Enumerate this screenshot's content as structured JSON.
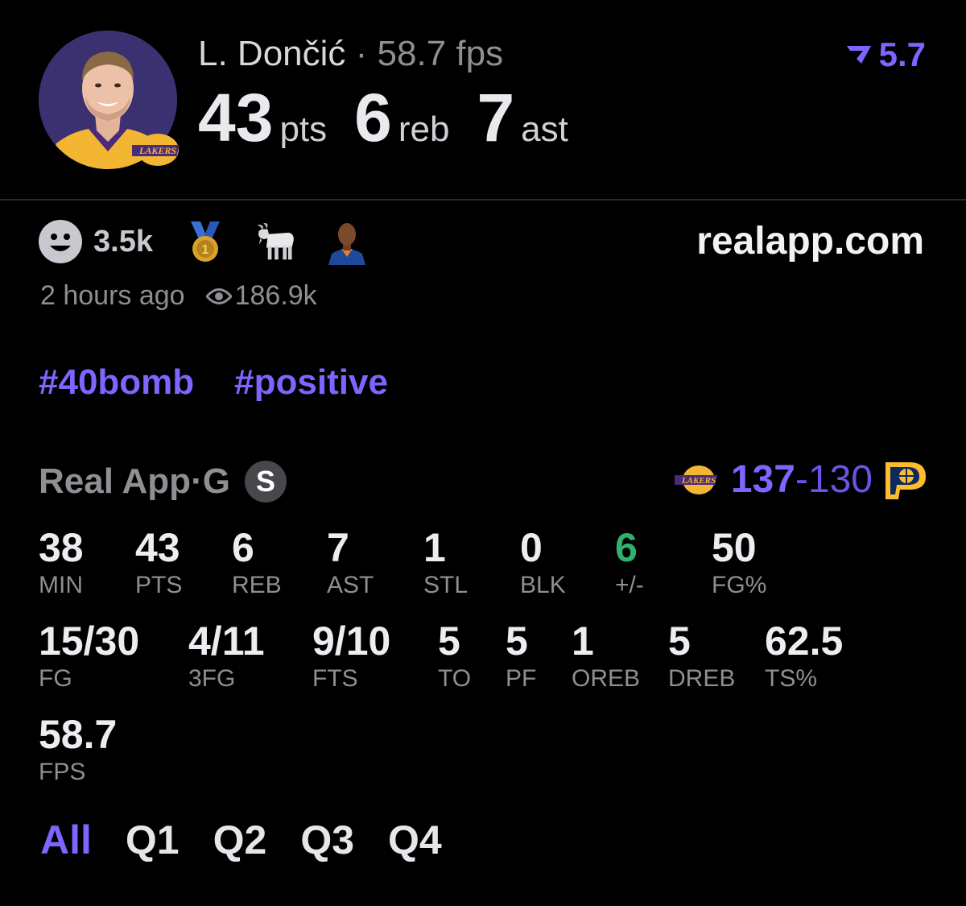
{
  "header": {
    "player_name": "L. Dončić",
    "separator": " · ",
    "fps_text": "58.7 fps",
    "pts": "43",
    "pts_unit": "pts",
    "reb": "6",
    "reb_unit": "reb",
    "ast": "7",
    "ast_unit": "ast",
    "vote_value": "5.7",
    "team_logo_text": "LAKERS"
  },
  "reactions": {
    "count": "3.5k",
    "medal_number": "1",
    "site": "realapp.com"
  },
  "meta": {
    "time": "2 hours ago",
    "views": "186.9k"
  },
  "tags": [
    "#40bomb",
    "#positive"
  ],
  "game": {
    "source": "Real App",
    "separator": " · ",
    "position": "G",
    "badge": "S",
    "score_win": "137",
    "score_dash": "-",
    "score_loss": "130",
    "home_logo_text": "LAKERS"
  },
  "stats": {
    "row1": [
      {
        "value": "38",
        "label": "MIN"
      },
      {
        "value": "43",
        "label": "PTS"
      },
      {
        "value": "6",
        "label": "REB"
      },
      {
        "value": "7",
        "label": "AST"
      },
      {
        "value": "1",
        "label": "STL"
      },
      {
        "value": "0",
        "label": "BLK"
      },
      {
        "value": "6",
        "label": "+/-"
      },
      {
        "value": "50",
        "label": "FG%"
      }
    ],
    "row2": [
      {
        "value": "15/30",
        "label": "FG"
      },
      {
        "value": "4/11",
        "label": "3FG"
      },
      {
        "value": "9/10",
        "label": "FTS"
      },
      {
        "value": "5",
        "label": "TO"
      },
      {
        "value": "5",
        "label": "PF"
      },
      {
        "value": "1",
        "label": "OREB"
      },
      {
        "value": "5",
        "label": "DREB"
      },
      {
        "value": "62.5",
        "label": "TS%"
      }
    ],
    "row3": [
      {
        "value": "58.7",
        "label": "FPS"
      }
    ]
  },
  "quarters": [
    "All",
    "Q1",
    "Q2",
    "Q3",
    "Q4"
  ],
  "colors": {
    "accent": "#7f64ff",
    "positive": "#2fb36b",
    "muted": "#8e8e93",
    "background": "#000000"
  }
}
